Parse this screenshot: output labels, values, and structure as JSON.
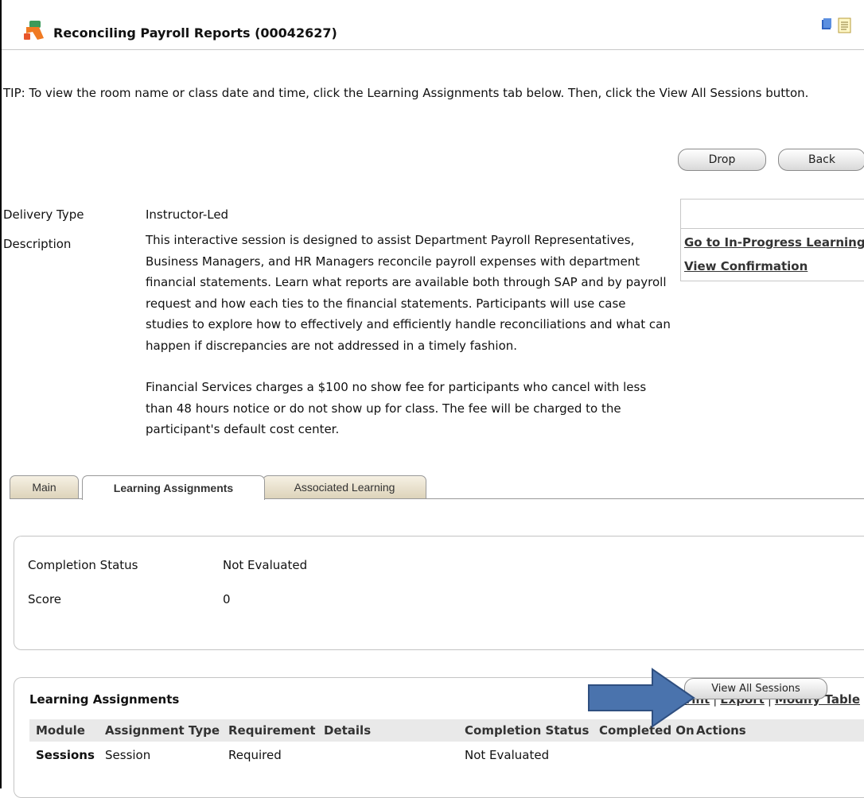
{
  "header": {
    "title": "Reconciling Payroll Reports (00042627)",
    "icons": [
      "course-logo-icon",
      "book-icon",
      "notes-icon"
    ]
  },
  "tip": "TIP: To view the room name or class date and time, click the Learning Assignments tab below. Then, click the View All Sessions button.",
  "actions": {
    "drop_label": "Drop",
    "back_label": "Back"
  },
  "details": {
    "delivery_type_label": "Delivery Type",
    "delivery_type_value": "Instructor-Led",
    "description_label": "Description",
    "description_p1": "This interactive session is designed to assist Department Payroll Representatives, Business Managers, and HR Managers reconcile payroll expenses with department financial statements. Learn what reports are available both through SAP and by payroll request and how each ties to the financial statements. Participants will use case studies to explore how to effectively and efficiently handle reconciliations and what can happen if discrepancies are not addressed in a timely fashion.",
    "description_p2": "Financial Services charges a $100 no show fee for participants who cancel with less than 48 hours notice or do not show up for class. The fee will be charged to the participant's default cost center."
  },
  "side_links": {
    "in_progress": "Go to In-Progress Learning",
    "confirmation": "View Confirmation"
  },
  "tabs": [
    {
      "label": "Main"
    },
    {
      "label": "Learning Assignments",
      "active": true
    },
    {
      "label": "Associated Learning"
    }
  ],
  "status": {
    "completion_label": "Completion Status",
    "completion_value": "Not Evaluated",
    "score_label": "Score",
    "score_value": "0"
  },
  "learning_assignments": {
    "title": "Learning Assignments",
    "links": {
      "print": "Print",
      "export": "Export",
      "modify": "Modify Table",
      "separator": "|"
    },
    "columns": [
      "Module",
      "Assignment Type",
      "Requirement",
      "Details",
      "Completion Status",
      "Completed On",
      "Actions"
    ],
    "rows": [
      {
        "module": "Sessions",
        "assignment_type": "Session",
        "requirement": "Required",
        "details": "",
        "completion_status": "Not Evaluated",
        "completed_on": "",
        "action_label": "View All Sessions"
      }
    ]
  },
  "colors": {
    "arrow": "#4a73ad",
    "arrow_border": "#2f4f80",
    "tab_inactive": "#e8e0c9"
  }
}
